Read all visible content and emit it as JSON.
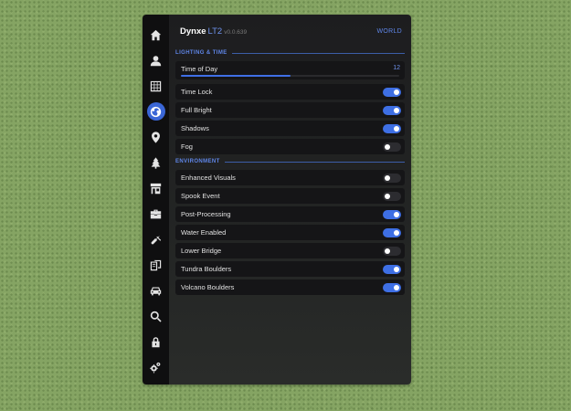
{
  "header": {
    "app_name": "Dynxe",
    "app_sub": "LT2",
    "version": "v0.0.639",
    "world_button": "WORLD"
  },
  "sidebar": {
    "items": [
      {
        "icon": "home-icon",
        "active": false
      },
      {
        "icon": "user-icon",
        "active": false
      },
      {
        "icon": "grid-icon",
        "active": false
      },
      {
        "icon": "globe-icon",
        "active": true
      },
      {
        "icon": "map-pin-icon",
        "active": false
      },
      {
        "icon": "tree-icon",
        "active": false
      },
      {
        "icon": "store-icon",
        "active": false
      },
      {
        "icon": "toolbox-icon",
        "active": false
      },
      {
        "icon": "hammer-icon",
        "active": false
      },
      {
        "icon": "blueprint-icon",
        "active": false
      },
      {
        "icon": "car-icon",
        "active": false
      },
      {
        "icon": "search-icon",
        "active": false
      },
      {
        "icon": "lock-icon",
        "active": false
      },
      {
        "icon": "gears-icon",
        "active": false
      }
    ]
  },
  "lighting": {
    "title": "LIGHTING & TIME",
    "time_of_day": {
      "label": "Time of Day",
      "value": "12",
      "fraction": 0.5
    },
    "toggles": [
      {
        "label": "Time Lock",
        "on": true
      },
      {
        "label": "Full Bright",
        "on": true
      },
      {
        "label": "Shadows",
        "on": true
      },
      {
        "label": "Fog",
        "on": false
      }
    ]
  },
  "environment": {
    "title": "ENVIRONMENT",
    "toggles": [
      {
        "label": "Enhanced Visuals",
        "on": false
      },
      {
        "label": "Spook Event",
        "on": false
      },
      {
        "label": "Post-Processing",
        "on": true
      },
      {
        "label": "Water Enabled",
        "on": true
      },
      {
        "label": "Lower Bridge",
        "on": false
      },
      {
        "label": "Tundra Boulders",
        "on": true
      },
      {
        "label": "Volcano Boulders",
        "on": true
      }
    ]
  },
  "colors": {
    "accent": "#3e6fe4",
    "panel": "#1d1d1f",
    "sidebar": "#0f0f10",
    "grass": "#85a463"
  }
}
